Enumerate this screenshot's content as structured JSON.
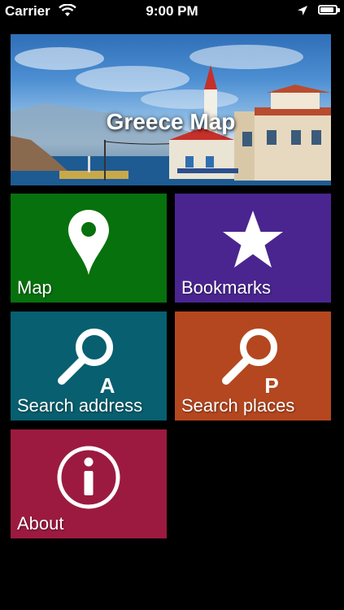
{
  "status_bar": {
    "carrier": "Carrier",
    "time": "9:00 PM",
    "battery_level": 0.9
  },
  "banner": {
    "title": "Greece Map"
  },
  "tiles": [
    {
      "label": "Map",
      "icon": "map-pin-icon",
      "color": "#07710d"
    },
    {
      "label": "Bookmarks",
      "icon": "star-icon",
      "color": "#4a2590"
    },
    {
      "label": "Search address",
      "icon": "search-address-icon",
      "badge": "A",
      "color": "#075f6f"
    },
    {
      "label": "Search places",
      "icon": "search-places-icon",
      "badge": "P",
      "color": "#b4471f"
    },
    {
      "label": "About",
      "icon": "info-icon",
      "color": "#9c1a40"
    }
  ]
}
